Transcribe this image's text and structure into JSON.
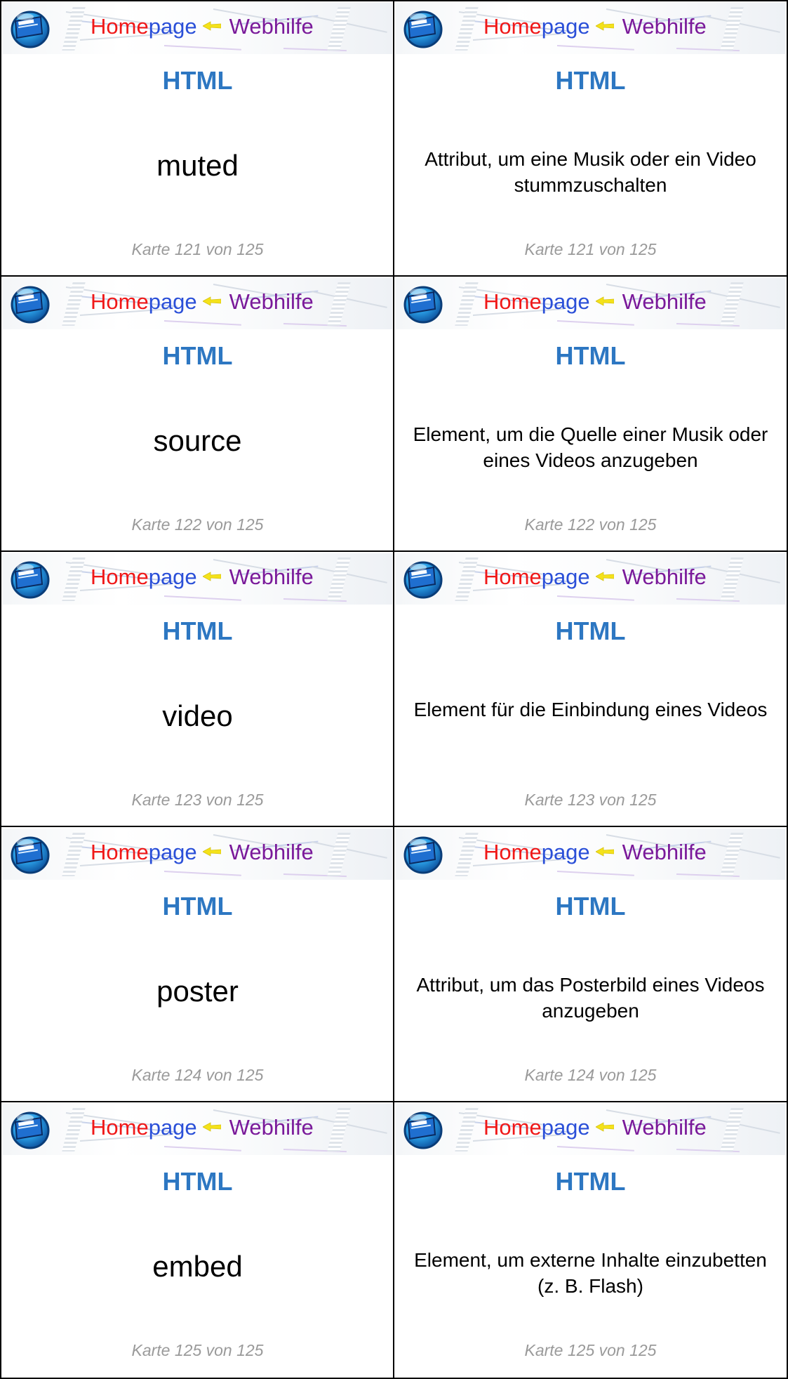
{
  "brand": {
    "home": "Home",
    "page": "page",
    "webhilfe": "Webhilfe",
    "logo_text": "HOMEPAGE WEBHILFE"
  },
  "colors": {
    "topic": "#2d77c2",
    "brand_home": "#f01818",
    "brand_page": "#2a4fd8",
    "brand_webhilfe": "#7a1a9a",
    "arrow": "#f4e21a",
    "counter": "#9a9a9a"
  },
  "icons": [
    "homepage-webhilfe-logo-icon",
    "yellow-arrow-icon"
  ],
  "cards": [
    {
      "topic": "HTML",
      "term": "muted",
      "definition": "Attribut, um eine Musik oder ein Video stummzuschalten",
      "counter": "Karte 121 von 125"
    },
    {
      "topic": "HTML",
      "term": "source",
      "definition": "Element, um die Quelle einer Musik oder eines Videos anzugeben",
      "counter": "Karte 122 von 125"
    },
    {
      "topic": "HTML",
      "term": "video",
      "definition": "Element für die Einbindung eines Videos",
      "counter": "Karte 123 von 125"
    },
    {
      "topic": "HTML",
      "term": "poster",
      "definition": "Attribut, um das Posterbild eines Videos anzugeben",
      "counter": "Karte 124 von 125"
    },
    {
      "topic": "HTML",
      "term": "embed",
      "definition": "Element, um externe Inhalte einzubetten (z. B. Flash)",
      "counter": "Karte 125 von 125"
    }
  ]
}
